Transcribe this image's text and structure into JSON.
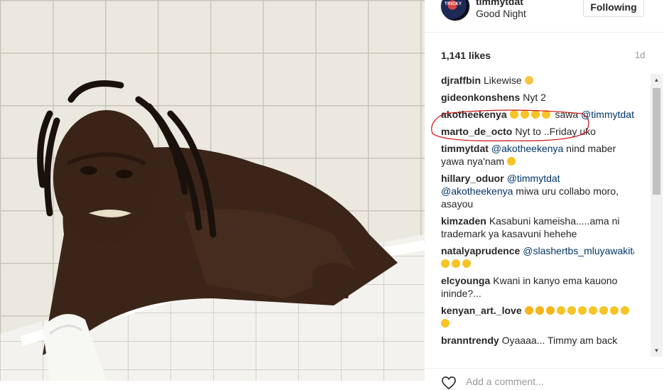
{
  "post": {
    "username": "timmytdat",
    "location": "Good Night",
    "follow_label": "Following",
    "avatar_text": "TRICKY",
    "likes": "1,141 likes",
    "time": "1d",
    "add_comment_placeholder": "Add a comment..."
  },
  "comments": [
    {
      "user": "djraffbin",
      "parts": [
        {
          "t": "text",
          "v": "Likewise "
        },
        {
          "t": "emoji",
          "v": "sad"
        }
      ]
    },
    {
      "user": "gideonkonshens",
      "parts": [
        {
          "t": "text",
          "v": "Nyt 2"
        }
      ]
    },
    {
      "user": "akotheekenya",
      "parts": [
        {
          "t": "emoji",
          "v": "laugh"
        },
        {
          "t": "emoji",
          "v": "laugh"
        },
        {
          "t": "emoji",
          "v": "laugh"
        },
        {
          "t": "emoji",
          "v": "laugh"
        },
        {
          "t": "text",
          "v": " sawa "
        },
        {
          "t": "mention",
          "v": "@timmytdat"
        }
      ]
    },
    {
      "user": "marto_de_octo",
      "parts": [
        {
          "t": "text",
          "v": "Nyt to ..Friday uko"
        }
      ]
    },
    {
      "user": "timmytdat",
      "parts": [
        {
          "t": "mention",
          "v": "@akotheekenya"
        },
        {
          "t": "text",
          "v": " nind maber yawa nya'nam "
        },
        {
          "t": "emoji",
          "v": "laugh"
        }
      ]
    },
    {
      "user": "hillary_oduor",
      "parts": [
        {
          "t": "mention",
          "v": "@timmytdat"
        },
        {
          "t": "text",
          "v": " "
        },
        {
          "t": "mention",
          "v": "@akotheekenya"
        },
        {
          "t": "text",
          "v": " miwa uru collabo moro, asayou"
        }
      ]
    },
    {
      "user": "kimzaden",
      "parts": [
        {
          "t": "text",
          "v": "Kasabuni kameisha.....ama ni trademark ya kasavuni hehehe"
        }
      ]
    },
    {
      "user": "natalyaprudence",
      "parts": [
        {
          "t": "mention",
          "v": "@slashertbs_mluyawakitale"
        },
        {
          "t": "text",
          "v": " "
        },
        {
          "t": "emoji",
          "v": "laugh"
        },
        {
          "t": "emoji",
          "v": "laugh"
        },
        {
          "t": "emoji",
          "v": "laugh"
        }
      ]
    },
    {
      "user": "elcyounga",
      "parts": [
        {
          "t": "text",
          "v": "Kwani in kanyo ema kauono ininde?..."
        }
      ]
    },
    {
      "user": "kenyan_art._love",
      "parts": [
        {
          "t": "emoji",
          "v": "wow"
        },
        {
          "t": "emoji",
          "v": "wow"
        },
        {
          "t": "emoji",
          "v": "wow"
        },
        {
          "t": "emoji",
          "v": "laugh"
        },
        {
          "t": "emoji",
          "v": "laugh"
        },
        {
          "t": "emoji",
          "v": "laugh"
        },
        {
          "t": "emoji",
          "v": "laugh"
        },
        {
          "t": "emoji",
          "v": "laugh"
        },
        {
          "t": "emoji",
          "v": "laugh"
        },
        {
          "t": "emoji",
          "v": "laugh"
        },
        {
          "t": "emoji",
          "v": "laugh"
        }
      ]
    },
    {
      "user": "branntrendy",
      "parts": [
        {
          "t": "text",
          "v": "Oyaaaa... Timmy am back"
        }
      ]
    }
  ],
  "icons": {
    "heart": "heart-icon",
    "scroll_up": "scroll-up-icon",
    "scroll_down": "scroll-down-icon"
  },
  "colors": {
    "mention": "#003569",
    "highlight": "#cc1111",
    "follow_border": "#dbdbdb"
  }
}
